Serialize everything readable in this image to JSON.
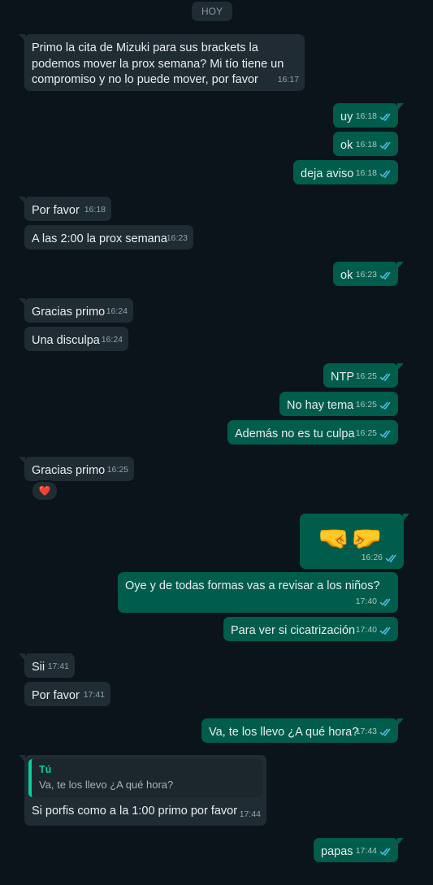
{
  "date_separator": "HOY",
  "messages": [
    {
      "text": "Primo la cita de Mizuki para sus brackets la podemos mover la prox semana? Mi tío tiene un compromiso y no lo puede mover, por favor",
      "time": "16:17"
    },
    {
      "text": "uy",
      "time": "16:18"
    },
    {
      "text": "ok",
      "time": "16:18"
    },
    {
      "text": "deja aviso",
      "time": "16:18"
    },
    {
      "text": "Por favor",
      "time": "16:18"
    },
    {
      "text": "A las 2:00 la prox semana",
      "time": "16:23"
    },
    {
      "text": "ok",
      "time": "16:23"
    },
    {
      "text": "Gracias primo",
      "time": "16:24"
    },
    {
      "text": "Una disculpa",
      "time": "16:24"
    },
    {
      "text": "NTP",
      "time": "16:25"
    },
    {
      "text": "No hay tema",
      "time": "16:25"
    },
    {
      "text": "Además no es tu culpa",
      "time": "16:25"
    },
    {
      "text": "Gracias primo",
      "time": "16:25",
      "reaction": "❤️"
    },
    {
      "text": "🤜🤛",
      "time": "16:26"
    },
    {
      "text": "Oye y de todas formas vas a revisar a los niños?",
      "time": "17:40"
    },
    {
      "text": "Para ver si cicatrización",
      "time": "17:40"
    },
    {
      "text": "Sii",
      "time": "17:41"
    },
    {
      "text": "Por favor",
      "time": "17:41"
    },
    {
      "text": "Va, te los llevo ¿A qué hora?",
      "time": "17:43"
    },
    {
      "text": "Si porfis como a la 1:00 primo por favor",
      "time": "17:44",
      "quote_author": "Tú",
      "quote_text": "Va, te los llevo ¿A qué hora?"
    },
    {
      "text": "papas",
      "time": "17:44"
    }
  ],
  "colors": {
    "background": "#0b141a",
    "incoming": "#1f2c34",
    "outgoing": "#005c4b",
    "read_ticks": "#53bdeb",
    "quote_accent": "#06cf9c"
  }
}
